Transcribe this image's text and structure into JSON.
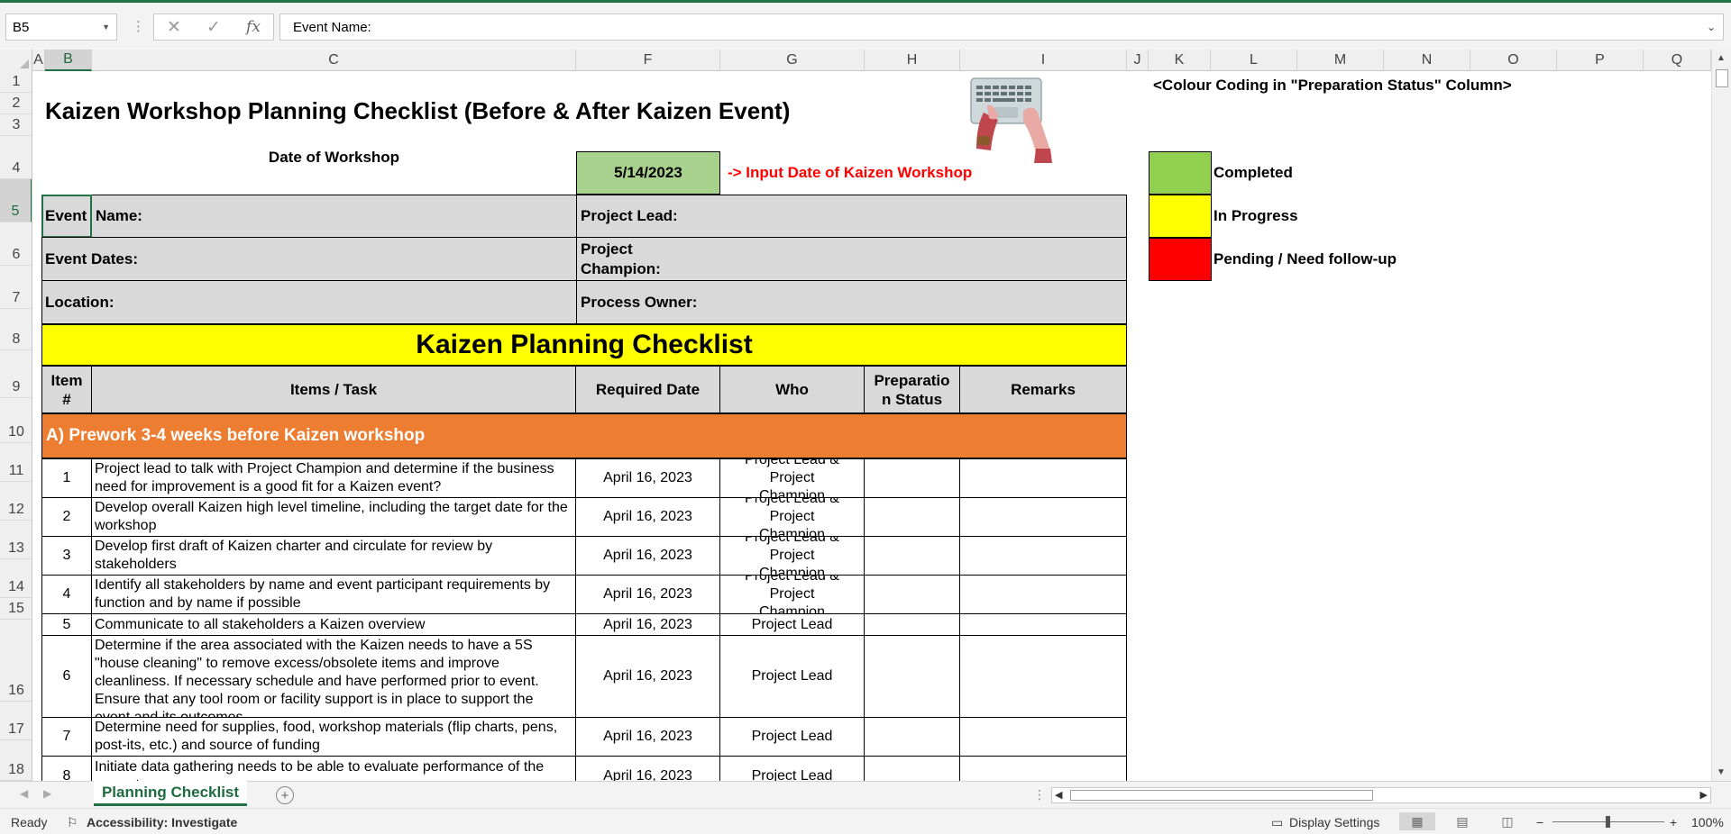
{
  "formula_bar": {
    "name_box": "B5",
    "cancel_symbol": "✕",
    "enter_symbol": "✓",
    "fx_symbol": "fx",
    "content": "Event Name:"
  },
  "columns": [
    "A",
    "B",
    "C",
    "F",
    "G",
    "H",
    "I",
    "J",
    "K",
    "L",
    "M",
    "N",
    "O",
    "P",
    "Q"
  ],
  "rows": [
    "1",
    "2",
    "3",
    "4",
    "5",
    "6",
    "7",
    "8",
    "9",
    "10",
    "11",
    "12",
    "13",
    "14",
    "15",
    "16",
    "17",
    "18"
  ],
  "sheet": {
    "title": "Kaizen Workshop Planning Checklist (Before & After Kaizen Event)",
    "date_label": "Date of Workshop",
    "date_value": "5/14/2023",
    "date_instruction": "-> Input Date of Kaizen Workshop",
    "info": {
      "event_label": "Event",
      "name_label": "Name:",
      "project_lead": "Project Lead:",
      "event_dates": "Event Dates:",
      "project_champion_1": "Project",
      "project_champion_2": "Champion:",
      "location": "Location:",
      "process_owner": "Process Owner:"
    },
    "banner": "Kaizen Planning Checklist",
    "table_headers": {
      "item_1": "Item",
      "item_2": "#",
      "task": "Items / Task",
      "required_date": "Required Date",
      "who": "Who",
      "status_1": "Preparatio",
      "status_2": "n Status",
      "remarks": "Remarks"
    },
    "section_a": "A) Prework 3-4 weeks before Kaizen workshop",
    "tasks": [
      {
        "num": "1",
        "task": "Project lead to talk with Project Champion and determine if the business need for improvement is a good fit for a Kaizen event?",
        "date": "April 16, 2023",
        "who": "Project Lead & Project Champion"
      },
      {
        "num": "2",
        "task": "Develop overall Kaizen high level timeline, including the target date for the workshop",
        "date": "April 16, 2023",
        "who": "Project Lead & Project Champion"
      },
      {
        "num": "3",
        "task": "Develop first draft of Kaizen charter and circulate for review by stakeholders",
        "date": "April 16, 2023",
        "who": "Project Lead & Project Champion"
      },
      {
        "num": "4",
        "task": "Identify all stakeholders by name and event participant requirements by function and by name if possible",
        "date": "April 16, 2023",
        "who": "Project Lead & Project Champion"
      },
      {
        "num": "5",
        "task": "Communicate to all stakeholders a Kaizen overview",
        "date": "April 16, 2023",
        "who": "Project Lead"
      },
      {
        "num": "6",
        "task": "Determine if the area associated with the Kaizen needs to have a 5S \"house cleaning\" to remove excess/obsolete items and improve cleanliness. If necessary schedule and have performed prior to event. Ensure that any tool room or facility support is in place to support the event and its outcomes",
        "date": "April 16, 2023",
        "who": "Project Lead"
      },
      {
        "num": "7",
        "task": "Determine need for supplies, food, workshop materials (flip charts, pens, post-its, etc.) and source of funding",
        "date": "April 16, 2023",
        "who": "Project Lead"
      },
      {
        "num": "8",
        "task": "Initiate data gathering needs to be able to evaluate performance of the current process",
        "date": "April 16, 2023",
        "who": "Project Lead"
      }
    ],
    "legend": {
      "title": "<Colour Coding in \"Preparation Status\" Column>",
      "items": [
        {
          "label": "Completed",
          "color": "#92d050"
        },
        {
          "label": "In Progress",
          "color": "#ffff00"
        },
        {
          "label": "Pending / Need follow-up",
          "color": "#ff0000"
        }
      ]
    }
  },
  "tabs": {
    "active": "Planning Checklist",
    "add_symbol": "+"
  },
  "status_bar": {
    "ready": "Ready",
    "accessibility": "Accessibility: Investigate",
    "display_settings": "Display Settings",
    "zoom_minus": "−",
    "zoom_plus": "+",
    "zoom": "100%"
  },
  "colors": {
    "accent": "#217346",
    "date_fill": "#a9d18e",
    "banner_fill": "#ffff00",
    "section_fill": "#ed7d31",
    "header_fill": "#d9d9d9"
  }
}
